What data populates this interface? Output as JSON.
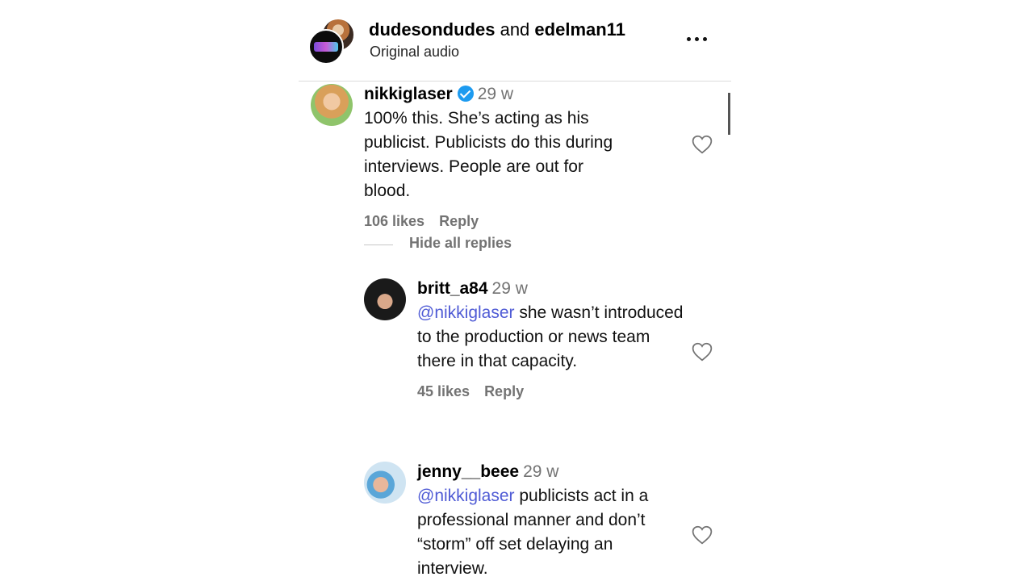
{
  "header": {
    "user1": "dudesondudes",
    "and": "and",
    "user2": "edelman11",
    "subtitle": "Original audio"
  },
  "comments": [
    {
      "username": "nikkiglaser",
      "verified": true,
      "time": "29 w",
      "text": "100% this. She’s acting as his publicist. Publicists do this during interviews. People are out for blood.",
      "likes": "106 likes",
      "reply": "Reply"
    }
  ],
  "hide_replies": "Hide all replies",
  "replies": [
    {
      "username": "britt_a84",
      "time": "29 w",
      "mention": "@nikkiglaser",
      "text": " she wasn’t introduced to the production or news team there in that capacity.",
      "likes": "45 likes",
      "reply": "Reply"
    },
    {
      "username": "jenny__beee",
      "time": "29 w",
      "mention": "@nikkiglaser",
      "text": " publicists act in a professional manner and don’t “storm” off set delaying an interview."
    }
  ],
  "icons": {
    "more": "more-options-icon",
    "like": "heart-outline-icon",
    "verified": "verified-badge-icon"
  }
}
